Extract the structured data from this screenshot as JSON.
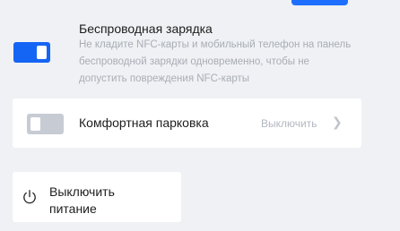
{
  "wireless_charging": {
    "title": "Беспроводная зарядка",
    "description": "Не кладите NFC-карты и мобильный телефон на панель беспроводной зарядки одновременно, чтобы не допустить повреждения NFC-карты",
    "enabled": true
  },
  "comfort_parking": {
    "title": "Комфортная парковка",
    "value": "Выключить",
    "enabled": false
  },
  "power": {
    "label": "Выключить питание"
  },
  "colors": {
    "accent": "#1565f5",
    "toggle_off": "#c7cbd3",
    "background": "#eff1f4"
  }
}
